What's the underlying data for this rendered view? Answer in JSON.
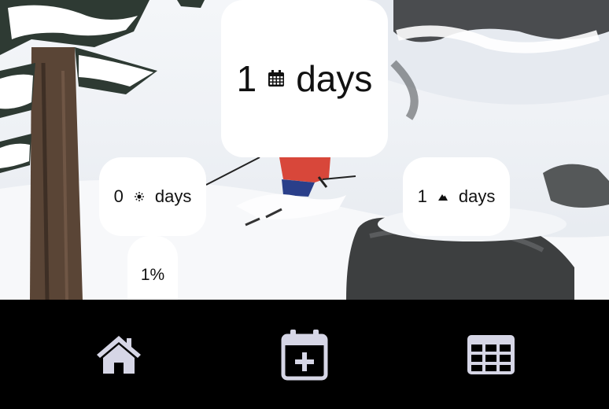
{
  "cards": {
    "total_days": {
      "value": "1",
      "unit": "days",
      "icon": "calendar-icon"
    },
    "sun_days": {
      "value": "0",
      "unit": "days",
      "icon": "sun-icon"
    },
    "mountain_days": {
      "value": "1",
      "unit": "days",
      "icon": "mountain-icon"
    },
    "percent": {
      "value": "1%"
    }
  },
  "nav": {
    "items": [
      {
        "icon": "home-icon"
      },
      {
        "icon": "calendar-add-icon"
      },
      {
        "icon": "grid-icon"
      }
    ],
    "icon_color": "#d6d6e6"
  },
  "colors": {
    "card_bg": "#ffffff",
    "nav_bg": "#000000"
  }
}
